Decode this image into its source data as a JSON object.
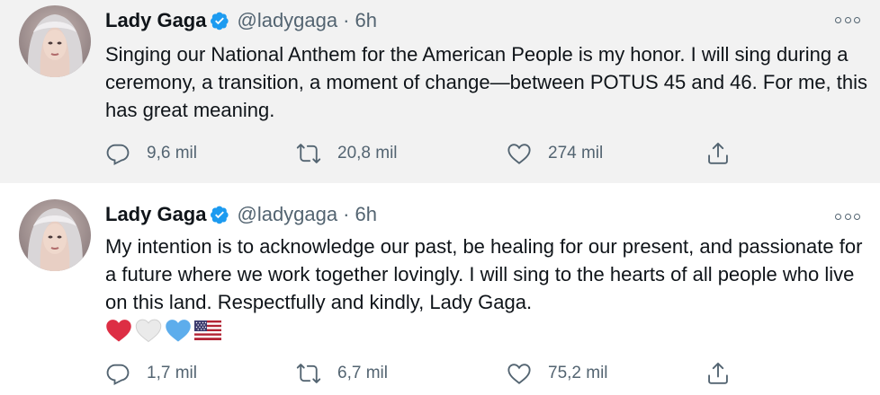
{
  "tweets": [
    {
      "author": {
        "name": "Lady Gaga",
        "handle": "@ladygaga",
        "verified": true
      },
      "separator": "·",
      "time": "6h",
      "text": "Singing our National Anthem for the  American People is my honor.  I will sing during a ceremony, a transition, a moment of change—between POTUS 45 and 46.  For me, this has great meaning.",
      "stats": {
        "replies": "9,6 mil",
        "retweets": "20,8 mil",
        "likes": "274 mil"
      }
    },
    {
      "author": {
        "name": "Lady Gaga",
        "handle": "@ladygaga",
        "verified": true
      },
      "separator": "·",
      "time": "6h",
      "text": "My intention is to acknowledge our past, be healing for our present, and passionate for a future where we work together lovingly. I will sing to the hearts of all people who live on this land. Respectfully and kindly, Lady Gaga.",
      "emojis": [
        "red-heart",
        "white-heart",
        "blue-heart",
        "us-flag"
      ],
      "stats": {
        "replies": "1,7 mil",
        "retweets": "6,7 mil",
        "likes": "75,2 mil"
      }
    }
  ],
  "colors": {
    "verified_blue": "#1d9bf0",
    "secondary_text": "#536471",
    "highlight_background": "#f2f2f2"
  },
  "icons": [
    "more-icon",
    "reply-icon",
    "retweet-icon",
    "like-icon",
    "share-icon",
    "verified-icon"
  ]
}
